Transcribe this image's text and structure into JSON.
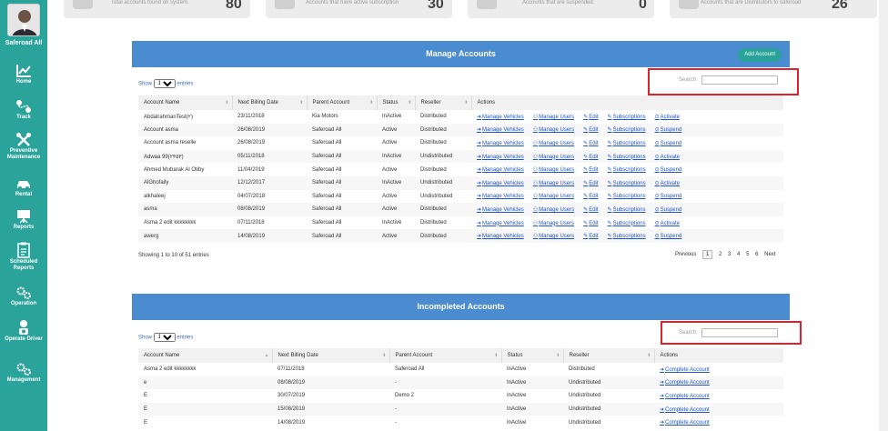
{
  "user": {
    "name": "Saferoad All"
  },
  "sidebar": [
    {
      "label": "Home",
      "icon": "chart-icon"
    },
    {
      "label": "Track",
      "icon": "route-icon"
    },
    {
      "label": "Preventive Maintenance",
      "icon": "tools-icon"
    },
    {
      "label": "Rental",
      "icon": "car-icon"
    },
    {
      "label": "Reports",
      "icon": "board-icon"
    },
    {
      "label": "Scheduled Reports",
      "icon": "clipboard-icon"
    },
    {
      "label": "Operation",
      "icon": "gears-icon"
    },
    {
      "label": "Operate Driver",
      "icon": "driver-icon"
    },
    {
      "label": "Management",
      "icon": "gears-icon"
    }
  ],
  "stats": [
    {
      "label": "Total accounts found on system.",
      "value": "80"
    },
    {
      "label": "Accounts that have active subscription",
      "value": "30"
    },
    {
      "label": "Accounts that are suspended.",
      "value": "0"
    },
    {
      "label": "Accounts that are Distributors to saferoad",
      "value": "26"
    }
  ],
  "manage": {
    "title": "Manage Accounts",
    "add_label": "Add Account",
    "show": "Show",
    "entries": "entries",
    "page_size": "10",
    "search_label": "Search:",
    "columns": [
      "Account Name",
      "Next Billing Date",
      "Parent Account",
      "Status",
      "Reseller",
      "Actions"
    ],
    "actions": [
      "Manage Vehicles",
      "Manage Users",
      "Edit",
      "Subscriptions"
    ],
    "rows": [
      [
        "AbdalrahmanTest(٢)",
        "23/11/2018",
        "Kia Motors",
        "InActive",
        "Distributed",
        "Activate"
      ],
      [
        "Account asma",
        "26/08/2019",
        "Saferoad All",
        "Active",
        "Distributed",
        "Suspend"
      ],
      [
        "Account asma reselle",
        "26/08/2019",
        "Saferoad All",
        "Active",
        "Distributed",
        "Suspend"
      ],
      [
        "Adwaa 99(٢٣٥٣)",
        "05/11/2018",
        "Saferoad All",
        "InActive",
        "Undistributed",
        "Activate"
      ],
      [
        "Ahmed Mubarak Al Otiby",
        "11/04/2019",
        "Saferoad All",
        "Active",
        "Distributed",
        "Suspend"
      ],
      [
        "AlGhofaily",
        "12/12/2017",
        "Saferoad All",
        "InActive",
        "Undistributed",
        "Activate"
      ],
      [
        "alkhaleej",
        "04/07/2018",
        "Saferoad All",
        "Active",
        "Undistributed",
        "Suspend"
      ],
      [
        "asma",
        "08/08/2019",
        "Saferoad All",
        "Active",
        "Distributed",
        "Suspend"
      ],
      [
        "Asma 2 edit kkkkkkkk",
        "07/11/2018",
        "Saferoad All",
        "InActive",
        "Distributed",
        "Activate"
      ],
      [
        "awerg",
        "14/08/2019",
        "Saferoad All",
        "Active",
        "Distributed",
        "Suspend"
      ]
    ],
    "info": "Showing 1 to 10 of 51 entries",
    "pager": {
      "prev": "Previous",
      "pages": [
        "1",
        "2",
        "3",
        "4",
        "5",
        "6"
      ],
      "next": "Next"
    }
  },
  "incomplete": {
    "title": "Incompleted Accounts",
    "show": "Show",
    "entries": "entries",
    "page_size": "10",
    "search_label": "Search:",
    "columns": [
      "Account Name",
      "Next Billing Date",
      "Parent Account",
      "Status",
      "Reseller",
      "Actions"
    ],
    "action": "Complete Account",
    "rows": [
      [
        "Asma 2 edit kkkkkkkk",
        "07/11/2018",
        "Saferoad All",
        "InActive",
        "Distributed"
      ],
      [
        "e",
        "08/08/2019",
        "-",
        "InActive",
        "Undistributed"
      ],
      [
        "E",
        "30/07/2019",
        "Demo 2",
        "InActive",
        "Undistributed"
      ],
      [
        "E",
        "15/08/2019",
        "-",
        "InActive",
        "Undistributed"
      ],
      [
        "E",
        "14/08/2019",
        "-",
        "InActive",
        "Undistributed"
      ]
    ]
  }
}
